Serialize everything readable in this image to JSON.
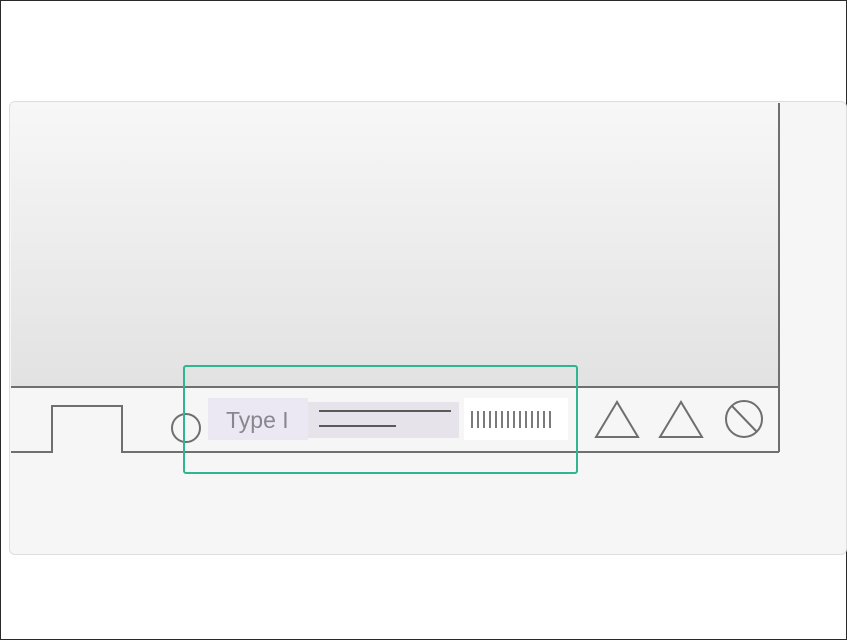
{
  "label_text": "Type I",
  "colors": {
    "highlight_box": "#2fb58f",
    "label_fill": "#ece8f3",
    "outline": "#6f6f6f",
    "card_background": "#f6f6f6"
  },
  "icons": [
    "rectangle-notch-shape",
    "circle-icon",
    "triangle-icon",
    "triangle-icon",
    "no-entry-icon"
  ]
}
